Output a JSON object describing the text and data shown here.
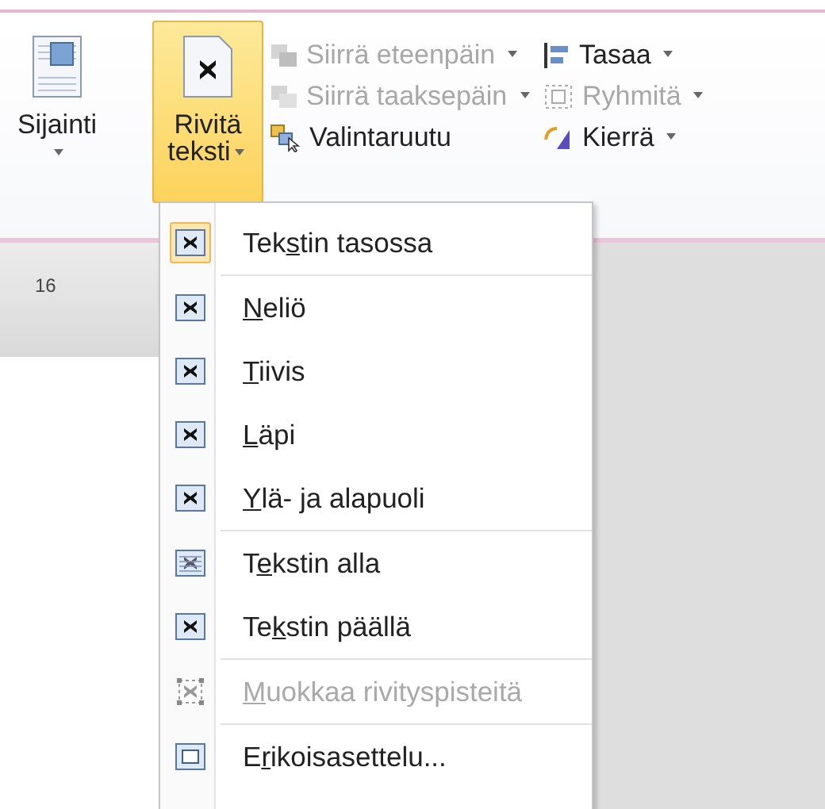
{
  "ribbon": {
    "large_buttons": [
      {
        "kind": "position",
        "label": "Sijainti",
        "pressed": false
      },
      {
        "kind": "wrap",
        "label": "Rivitä teksti",
        "pressed": true
      }
    ],
    "small_columns": [
      [
        {
          "kind": "forward",
          "label": "Siirrä eteenpäin",
          "dropdown": true,
          "disabled": true
        },
        {
          "kind": "backward",
          "label": "Siirrä taaksepäin",
          "dropdown": true,
          "disabled": true
        },
        {
          "kind": "selection",
          "label": "Valintaruutu",
          "dropdown": false,
          "disabled": false
        }
      ],
      [
        {
          "kind": "align",
          "label": "Tasaa",
          "dropdown": true,
          "disabled": false
        },
        {
          "kind": "group",
          "label": "Ryhmitä",
          "dropdown": true,
          "disabled": true
        },
        {
          "kind": "rotate",
          "label": "Kierrä",
          "dropdown": true,
          "disabled": false
        }
      ]
    ]
  },
  "ruler": {
    "mark": "16"
  },
  "menu": {
    "items": [
      {
        "kind": "inline",
        "pre": "Tek",
        "key": "s",
        "post": "tin tasossa",
        "selected": true,
        "disabled": false,
        "separator_after": true
      },
      {
        "kind": "square",
        "key": "N",
        "post": "eliö",
        "selected": false,
        "disabled": false,
        "separator_after": false
      },
      {
        "kind": "tight",
        "key": "T",
        "post": "iivis",
        "selected": false,
        "disabled": false,
        "separator_after": false
      },
      {
        "kind": "through",
        "key": "L",
        "post": "äpi",
        "selected": false,
        "disabled": false,
        "separator_after": false
      },
      {
        "kind": "topbottom",
        "key": "Y",
        "post": "lä- ja alapuoli",
        "selected": false,
        "disabled": false,
        "separator_after": true
      },
      {
        "kind": "behind",
        "pre": "T",
        "key": "e",
        "post": "kstin alla",
        "selected": false,
        "disabled": false,
        "separator_after": false
      },
      {
        "kind": "front",
        "pre": "Te",
        "key": "k",
        "post": "stin päällä",
        "selected": false,
        "disabled": false,
        "separator_after": true
      },
      {
        "kind": "editpoints",
        "key": "M",
        "post": "uokkaa rivityspisteitä",
        "selected": false,
        "disabled": true,
        "separator_after": true
      },
      {
        "kind": "more",
        "pre": "E",
        "key": "r",
        "post": "ikoisasettelu...",
        "selected": false,
        "disabled": false,
        "separator_after": false
      }
    ]
  }
}
